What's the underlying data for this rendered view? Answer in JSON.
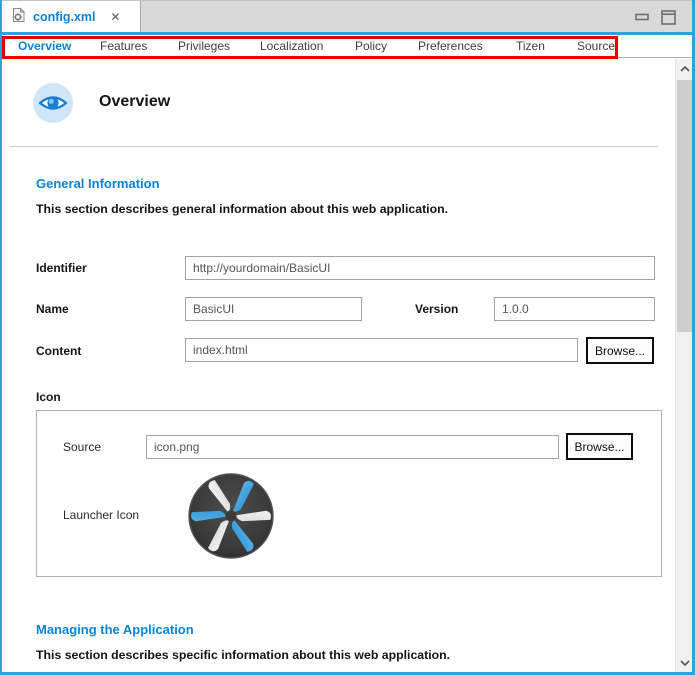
{
  "editor_tab": {
    "title": "config.xml",
    "close_glyph": "✕"
  },
  "window_controls": {
    "minimize": "minimize",
    "maximize": "maximize"
  },
  "nav": {
    "items": [
      {
        "label": "Overview",
        "selected": true
      },
      {
        "label": "Features",
        "selected": false
      },
      {
        "label": "Privileges",
        "selected": false
      },
      {
        "label": "Localization",
        "selected": false
      },
      {
        "label": "Policy",
        "selected": false
      },
      {
        "label": "Preferences",
        "selected": false
      },
      {
        "label": "Tizen",
        "selected": false
      },
      {
        "label": "Source",
        "selected": false
      }
    ]
  },
  "overview": {
    "title": "Overview",
    "general": {
      "heading": "General Information",
      "description": "This section describes general information about this web application."
    },
    "fields": {
      "identifier": {
        "label": "Identifier",
        "value": "http://yourdomain/BasicUI"
      },
      "name": {
        "label": "Name",
        "value": "BasicUI"
      },
      "version": {
        "label": "Version",
        "value": "1.0.0"
      },
      "content": {
        "label": "Content",
        "value": "index.html",
        "browse": "Browse..."
      }
    },
    "icon_section": {
      "label": "Icon",
      "source": {
        "label": "Source",
        "value": "icon.png",
        "browse": "Browse..."
      },
      "launcher": {
        "label": "Launcher Icon",
        "image": "tizen-pinwheel-logo"
      }
    },
    "managing": {
      "heading": "Managing the Application",
      "description": "This section describes specific information about this web application."
    }
  },
  "annotation": {
    "shape": "red-highlight-box",
    "color": "#e60000"
  },
  "icons": {
    "tab_file": "config-file-icon",
    "tab_close": "close-icon",
    "minimize": "minimize-icon",
    "maximize": "maximize-icon",
    "header": "eye-icon",
    "launcher": "tizen-pinwheel-logo",
    "scroll_up": "chevron-up-icon",
    "scroll_down": "chevron-down-icon"
  },
  "colors": {
    "frame_blue": "#2aa3e0",
    "heading_blue": "#0a84d8",
    "annotation_red": "#e60000",
    "tab_bar_gray": "#d9d9d9"
  }
}
